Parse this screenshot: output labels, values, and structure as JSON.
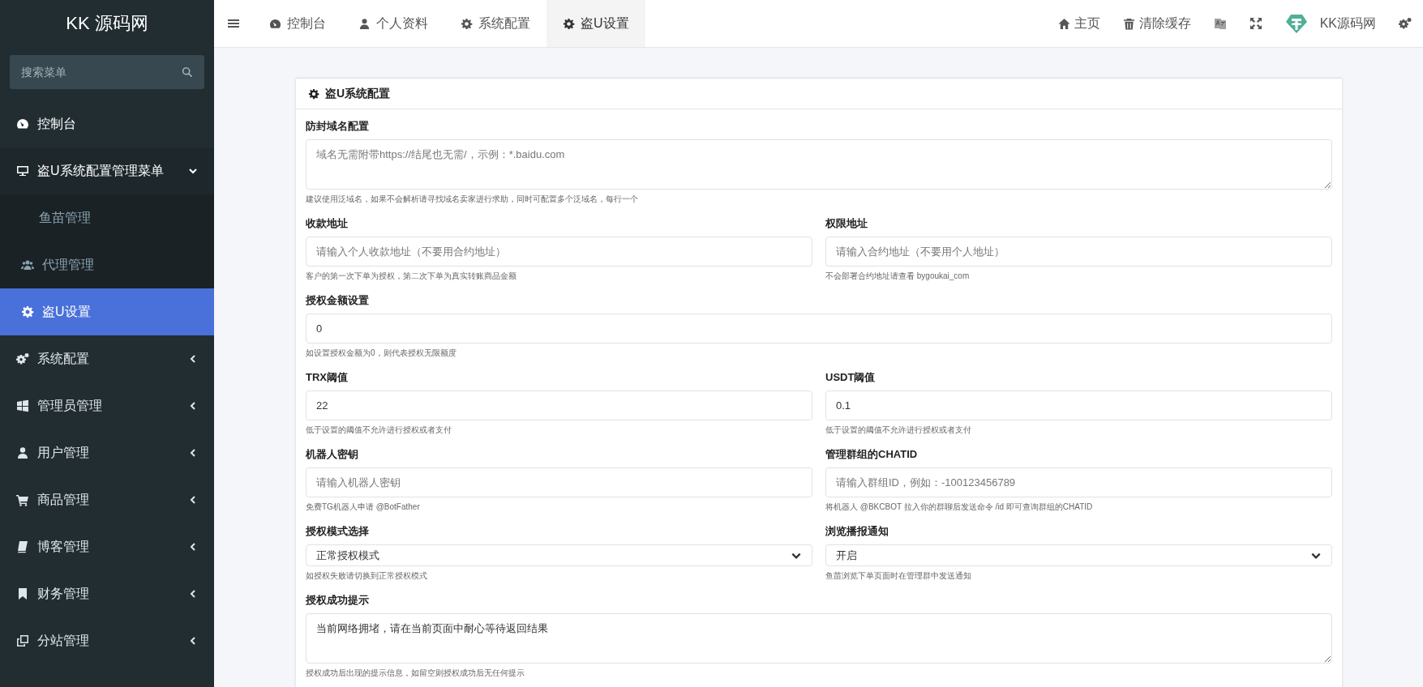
{
  "sidebar": {
    "logo": "KK 源码网",
    "search": {
      "placeholder": "搜索菜单"
    },
    "items": [
      {
        "label": "控制台",
        "selected": false
      },
      {
        "label": "盗U系统配置管理菜单",
        "selected": false,
        "expanded": true,
        "children": [
          {
            "label": "鱼苗管理",
            "selected": false
          },
          {
            "label": "代理管理",
            "selected": false
          },
          {
            "label": "盗U设置",
            "selected": true
          }
        ]
      },
      {
        "label": "系统配置",
        "selected": false,
        "expanded": false
      },
      {
        "label": "管理员管理",
        "selected": false,
        "expanded": false
      },
      {
        "label": "用户管理",
        "selected": false,
        "expanded": false
      },
      {
        "label": "商品管理",
        "selected": false,
        "expanded": false
      },
      {
        "label": "博客管理",
        "selected": false,
        "expanded": false
      },
      {
        "label": "财务管理",
        "selected": false,
        "expanded": false
      },
      {
        "label": "分站管理",
        "selected": false,
        "expanded": false
      }
    ]
  },
  "topbar": {
    "tabs": [
      {
        "label": "控制台",
        "selected": false
      },
      {
        "label": "个人资料",
        "selected": false
      },
      {
        "label": "系统配置",
        "selected": false
      },
      {
        "label": "盗U设置",
        "selected": true
      }
    ],
    "links": [
      {
        "kind": "text",
        "label": "主页"
      },
      {
        "kind": "text",
        "label": "清除缓存"
      },
      {
        "kind": "icon"
      },
      {
        "kind": "icon"
      },
      {
        "kind": "brand",
        "label": "KK源码网"
      },
      {
        "kind": "icon"
      }
    ]
  },
  "form": {
    "title": "盗U系统配置",
    "rows": [
      {
        "fields": [
          {
            "kind": "textarea",
            "label": "防封域名配置",
            "placeholder": "域名无需附带https://结尾也无需/，示例：*.baidu.com",
            "help": "建议使用泛域名，如果不会解析请寻找域名卖家进行求助，同时可配置多个泛域名，每行一个"
          }
        ]
      },
      {
        "fields": [
          {
            "kind": "input",
            "label": "收款地址",
            "placeholder": "请输入个人收款地址（不要用合约地址）",
            "help": "客户的第一次下单为授权，第二次下单为真实转账商品金额"
          },
          {
            "kind": "input",
            "label": "权限地址",
            "placeholder": "请输入合约地址（不要用个人地址）",
            "help": "不会部署合约地址请查看 bygoukai_com"
          }
        ]
      },
      {
        "fields": [
          {
            "kind": "input",
            "label": "授权金额设置",
            "value": "0",
            "help": "如设置授权金额为0，则代表授权无限额度"
          }
        ]
      },
      {
        "fields": [
          {
            "kind": "input",
            "label": "TRX阈值",
            "value": "22",
            "help": "低于设置的阈值不允许进行授权或者支付"
          },
          {
            "kind": "input",
            "label": "USDT阈值",
            "value": "0.1",
            "help": "低于设置的阈值不允许进行授权或者支付"
          }
        ]
      },
      {
        "fields": [
          {
            "kind": "input",
            "label": "机器人密钥",
            "placeholder": "请输入机器人密钥",
            "help": "免费TG机器人申请 @BotFather"
          },
          {
            "kind": "input",
            "label": "管理群组的CHATID",
            "placeholder": "请输入群组ID，例如：-100123456789",
            "help": "将机器人 @BKCBOT 拉入你的群聊后发送命令 /id 即可查询群组的CHATID"
          }
        ]
      },
      {
        "fields": [
          {
            "kind": "select",
            "label": "授权模式选择",
            "value": "正常授权模式",
            "help": "如授权失败请切换到正常授权模式"
          },
          {
            "kind": "select",
            "label": "浏览播报通知",
            "value": "开启",
            "help": "鱼苗浏览下单页面时在管理群中发送通知"
          }
        ]
      },
      {
        "fields": [
          {
            "kind": "textarea",
            "label": "授权成功提示",
            "value": "当前网络拥堵，请在当前页面中耐心等待返回结果",
            "help": "授权成功后出现的提示信息，如留空则授权成功后无任何提示"
          }
        ]
      }
    ]
  }
}
